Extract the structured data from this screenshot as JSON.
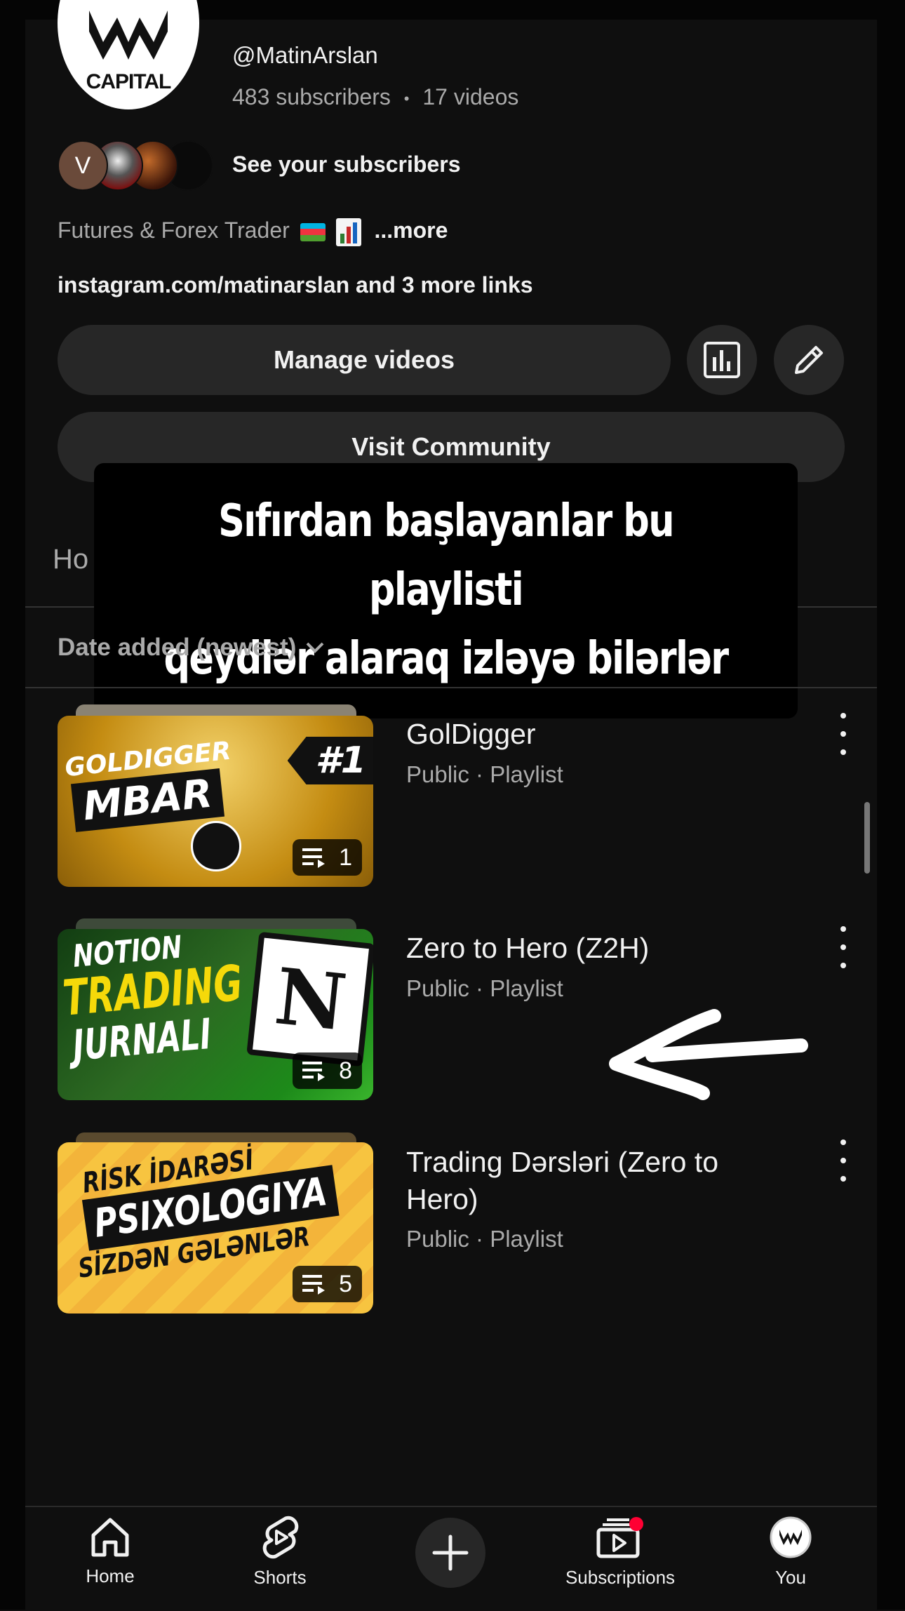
{
  "channel": {
    "handle": "@MatinArslan",
    "subscribers": "483 subscribers",
    "separator": "•",
    "videos": "17 videos",
    "avatar_text": "CAPITAL",
    "see_subscribers": "See your subscribers",
    "sub_avatar_initial": "V",
    "bio": "Futures & Forex Trader",
    "bio_more": "...more",
    "links": "instagram.com/matinarslan and 3 more links"
  },
  "actions": {
    "manage_videos": "Manage videos",
    "visit_community": "Visit Community"
  },
  "tab_peek": "Ho",
  "caption": {
    "line1": "Sıfırdan başlayanlar bu playlisti",
    "line2": "qeydlər alaraq izləyə bilərlər"
  },
  "sort": {
    "label": "Date added (newest)"
  },
  "playlists": [
    {
      "title": "GolDigger",
      "meta": "Public · Playlist",
      "count": "1",
      "thumb_lines": [
        "GOLDIGGER",
        "MBAR",
        "#1"
      ],
      "thumb_colors": {
        "bg": "#d4a21c",
        "accent": "#111111"
      }
    },
    {
      "title": "Zero to Hero (Z2H)",
      "meta": "Public · Playlist",
      "count": "8",
      "thumb_lines": [
        "NOTION",
        "TRADING",
        "JURNALI",
        "N"
      ],
      "thumb_colors": {
        "bg": "#1e5a1c",
        "accent": "#f5d90a"
      }
    },
    {
      "title": "Trading Dərsləri (Zero to Hero)",
      "meta": "Public · Playlist",
      "count": "5",
      "thumb_lines": [
        "RİSK İDARƏSİ",
        "PSIXOLOGIYA",
        "SİZDƏN GƏLƏNLƏR"
      ],
      "thumb_colors": {
        "bg": "#f5b731",
        "accent": "#111111"
      }
    }
  ],
  "nav": {
    "home": "Home",
    "shorts": "Shorts",
    "subscriptions": "Subscriptions",
    "you": "You"
  },
  "colors": {
    "background": "#0f0f0f",
    "surface": "#272727",
    "text_primary": "#f1f1f1",
    "text_secondary": "#aaaaaa",
    "notification_dot": "#ff0033"
  },
  "icons": [
    "analytics-icon",
    "pencil-icon",
    "chevron-down-icon",
    "playlist-icon",
    "more-vert-icon",
    "home-icon",
    "shorts-icon",
    "plus-icon",
    "subscriptions-icon",
    "arrow-annotation-icon"
  ]
}
